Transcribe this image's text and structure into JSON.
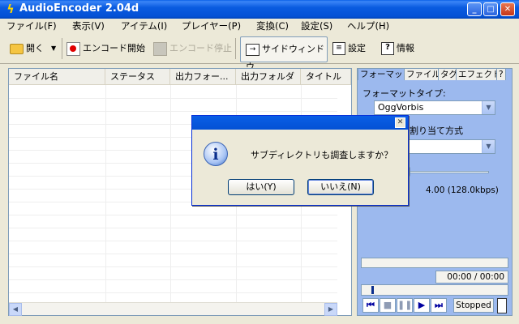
{
  "window": {
    "title": "AudioEncoder 2.04d"
  },
  "menu": [
    "ファイル(F)",
    "表示(V)",
    "アイテム(I)",
    "プレイヤー(P)",
    "変換(C)",
    "設定(S)",
    "ヘルプ(H)"
  ],
  "toolbar": {
    "open": "開く",
    "encode_start": "エンコード開始",
    "encode_stop": "エンコード停止",
    "side_window": "サイドウィンドウ",
    "settings": "設定",
    "info": "情報"
  },
  "list": {
    "columns": [
      "ファイル名",
      "ステータス",
      "出力フォー...",
      "出力フォルダ",
      "タイトル"
    ]
  },
  "panel": {
    "tabs": [
      "フォーマット",
      "ファイル",
      "タグ",
      "エフェクト",
      "?"
    ],
    "format_type_label": "フォーマットタイプ:",
    "format_type_value": "OggVorbis",
    "allocation_label": "割り当て方式",
    "quality_readout": "4.00 (128.0kbps)",
    "quality_fraction": 0.28,
    "time_readout": "00:00 / 00:00",
    "status": "Stopped"
  },
  "dialog": {
    "message": "サブディレクトリも調査しますか？",
    "yes": "はい(Y)",
    "no": "いいえ(N)"
  },
  "colors": {
    "title_blue": "#0A5BE0",
    "panel_blue": "#9CB9EE",
    "record_red": "#E00000"
  }
}
